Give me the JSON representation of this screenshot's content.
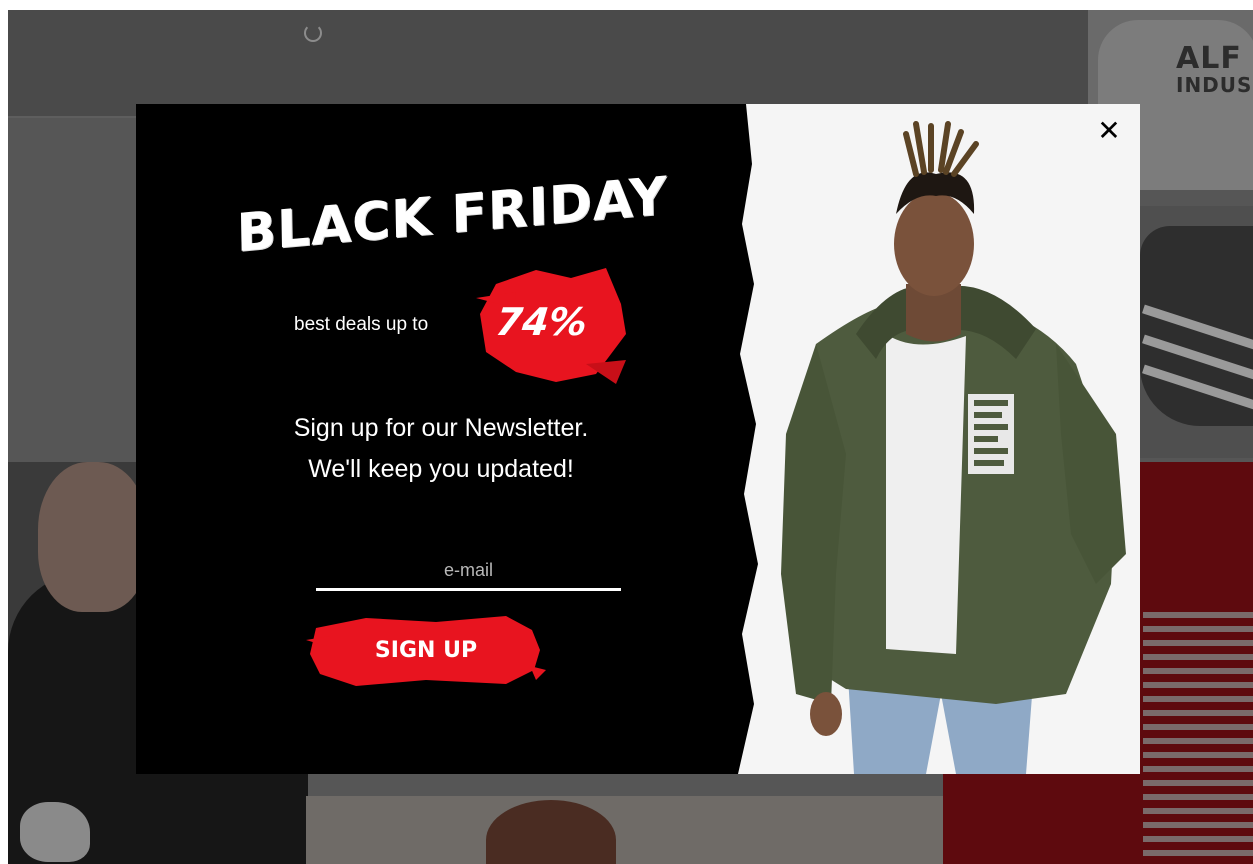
{
  "popup": {
    "headline": "BLACK FRIDAY",
    "deals_text": "best deals up to",
    "discount": "74%",
    "newsletter_line1": "Sign up for our Newsletter.",
    "newsletter_line2": "We'll keep you updated!",
    "email_placeholder": "e-mail",
    "email_value": "",
    "signup_label": "SIGN UP",
    "close_icon": "close-icon",
    "accent_color": "#e8141f"
  },
  "background": {
    "tshirt_print_line1": "ALF",
    "tshirt_print_line2": "INDUS"
  }
}
